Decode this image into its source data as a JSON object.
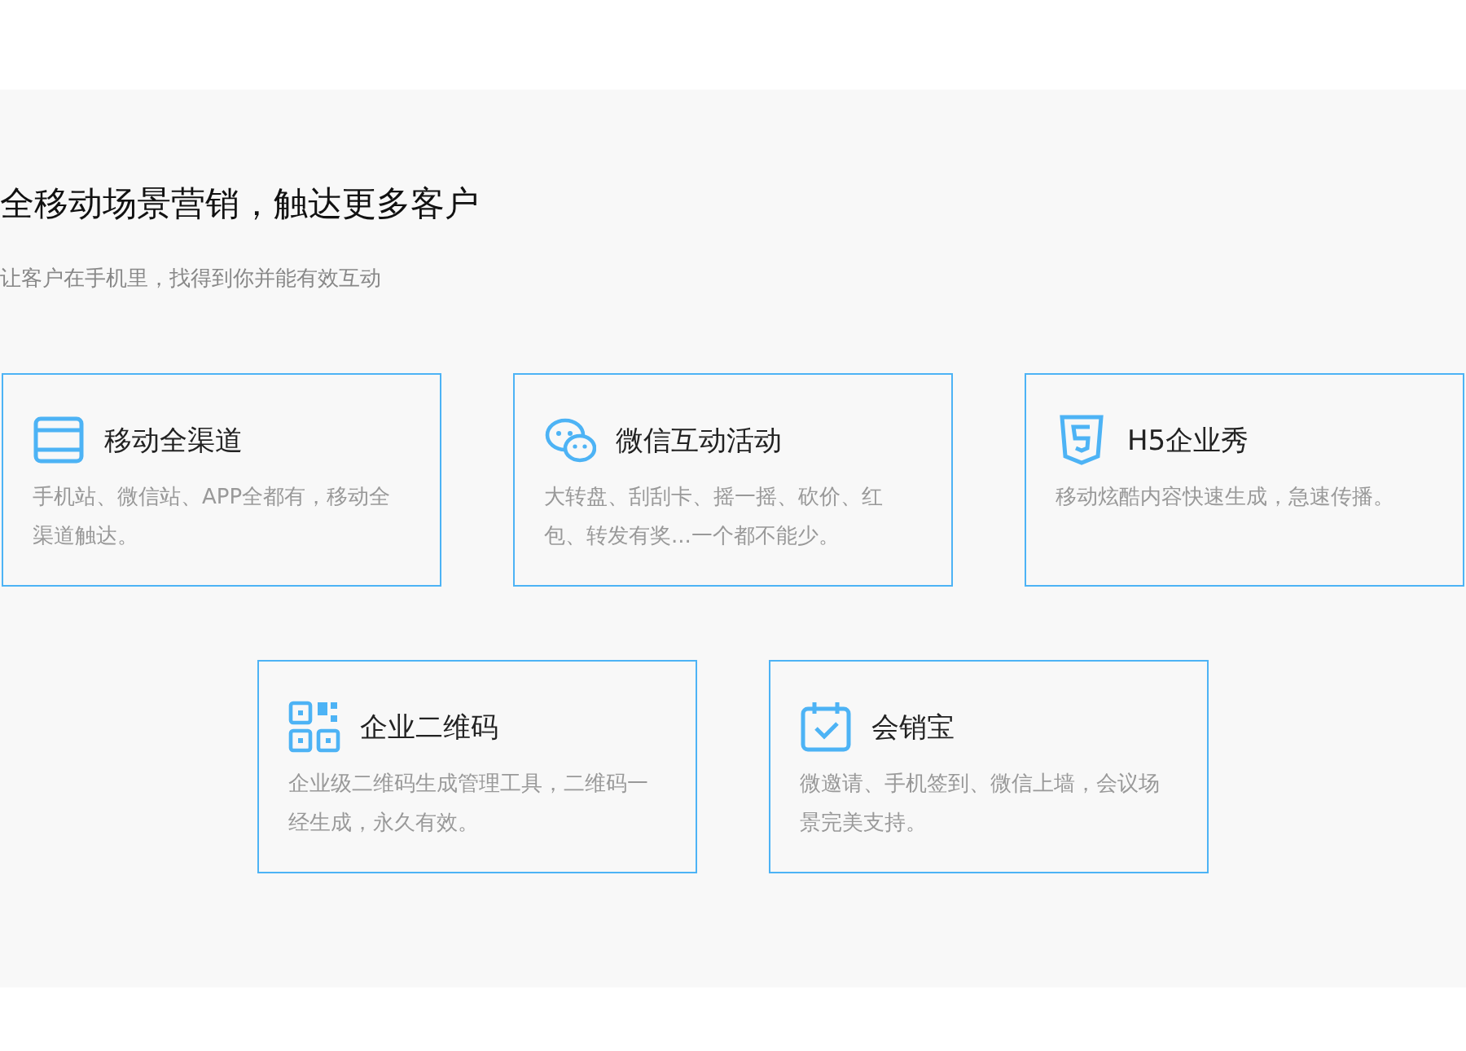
{
  "heading": "全移动场景营销，触达更多客户",
  "subheading": "让客户在手机里，找得到你并能有效互动",
  "rows": [
    {
      "cards": [
        {
          "title": "移动全渠道",
          "description": "手机站、微信站、APP全都有，移动全渠道触达。"
        },
        {
          "title": "微信互动活动",
          "description": "大转盘、刮刮卡、摇一摇、砍价、红包、转发有奖...一个都不能少。"
        },
        {
          "title": "H5企业秀",
          "description": "移动炫酷内容快速生成，急速传播。"
        }
      ]
    },
    {
      "cards": [
        {
          "title": "企业二维码",
          "description": "企业级二维码生成管理工具，二维码一经生成，永久有效。"
        },
        {
          "title": "会销宝",
          "description": "微邀请、手机签到、微信上墙，会议场景完美支持。"
        }
      ]
    }
  ]
}
